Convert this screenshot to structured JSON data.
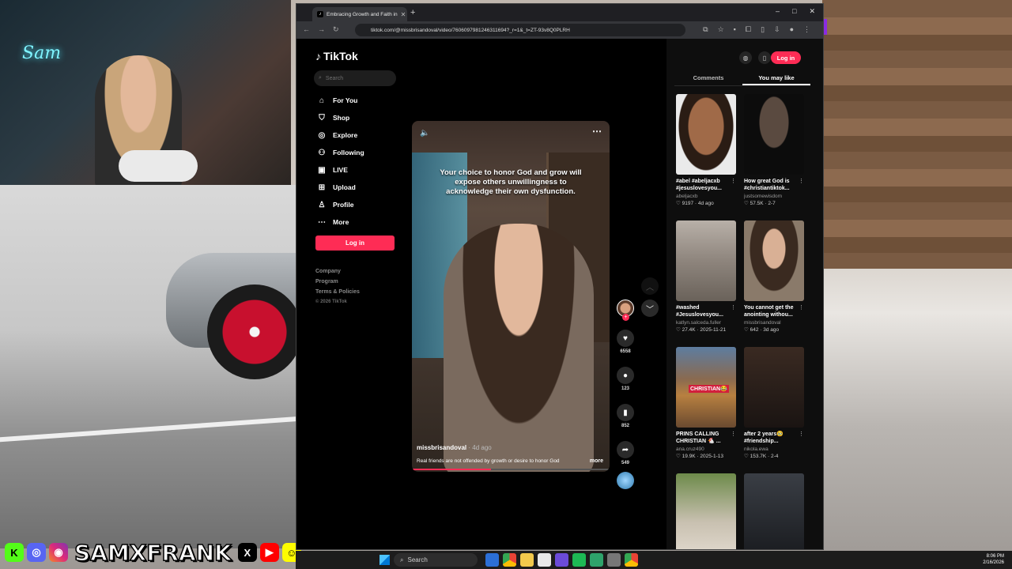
{
  "stream": {
    "neon_sign": "Sam",
    "channel_name": "SAMXFRANK",
    "socials": [
      {
        "icon": "kick-icon",
        "glyph": "K"
      },
      {
        "icon": "discord-icon",
        "glyph": "◎"
      },
      {
        "icon": "instagram-icon",
        "glyph": "◉"
      },
      {
        "icon": "x-icon",
        "glyph": "X"
      },
      {
        "icon": "youtube-icon",
        "glyph": "▶"
      },
      {
        "icon": "snapchat-icon",
        "glyph": "☺"
      }
    ]
  },
  "browser": {
    "tab_title": "Embracing Growth and Faith in",
    "url": "tiktok.com/@missbrisandoval/video/7606097981246311694?_r=1&_t=ZT-93v8Q0PLRH",
    "new_tab": "+",
    "controls": {
      "min": "–",
      "max": "□",
      "close": "✕"
    }
  },
  "sidebar": {
    "logo": "TikTok",
    "search_placeholder": "Search",
    "nav": [
      {
        "label": "For You",
        "icon": "home-icon",
        "glyph": "⌂"
      },
      {
        "label": "Shop",
        "icon": "shop-icon",
        "glyph": "⛉"
      },
      {
        "label": "Explore",
        "icon": "compass-icon",
        "glyph": "◎"
      },
      {
        "label": "Following",
        "icon": "following-icon",
        "glyph": "⚇"
      },
      {
        "label": "LIVE",
        "icon": "live-icon",
        "glyph": "▣"
      },
      {
        "label": "Upload",
        "icon": "upload-icon",
        "glyph": "⊞"
      },
      {
        "label": "Profile",
        "icon": "profile-icon",
        "glyph": "♙"
      },
      {
        "label": "More",
        "icon": "more-icon",
        "glyph": "⋯"
      }
    ],
    "login_label": "Log in",
    "footer": {
      "company": "Company",
      "program": "Program",
      "terms": "Terms & Policies",
      "copyright": "© 2026 TikTok"
    }
  },
  "video": {
    "caption_text": "Your choice to honor God and grow will expose others unwillingness to acknowledge their own dysfunction.",
    "author": "missbrisandoval",
    "age": "· 4d ago",
    "description": "Real friends are not offended by growth or desire to honor God",
    "more": "more",
    "progress": 0.4,
    "likes": "6558",
    "comments": "123",
    "saves": "852",
    "shares": "549"
  },
  "panel": {
    "login_label": "Log in",
    "tabs": [
      "Comments",
      "You may like"
    ],
    "cards": [
      {
        "title": "#abel #abeljacxb #jesuslovesyou...",
        "author": "abeljacxb",
        "meta": "♡ 9197 · 4d ago",
        "label": ""
      },
      {
        "title": "How great God is #christiantiktok...",
        "author": "justsomewisdom",
        "meta": "♡ 57.5K · 2-7",
        "label": ""
      },
      {
        "title": "#washed #Jesuslovesyou...",
        "author": "katlyn.salceda.fuller",
        "meta": "♡ 27.4K · 2025-11-21",
        "label": ""
      },
      {
        "title": "You cannot get the anointing withou...",
        "author": "missbrisandoval",
        "meta": "♡ 642 · 3d ago",
        "label": ""
      },
      {
        "title": "PRINS CALLING CHRISTIAN 🐔 ...",
        "author": "ana.cruz490",
        "meta": "♡ 19.9K · 2025-1-13",
        "label": "CHRISTIAN😂"
      },
      {
        "title": "after 2 years🥹 #friendship...",
        "author": "nikola.ewa",
        "meta": "♡ 153.7K · 2-4",
        "label": ""
      },
      {
        "title": "",
        "author": "",
        "meta": "",
        "label": ""
      },
      {
        "title": "",
        "author": "",
        "meta": "",
        "label": ""
      }
    ]
  },
  "taskbar": {
    "search": "Search",
    "time": "8:06 PM",
    "date": "2/16/2026"
  }
}
